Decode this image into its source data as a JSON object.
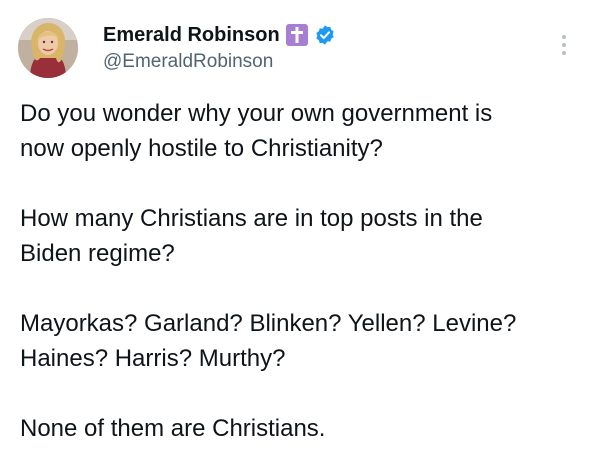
{
  "tweet": {
    "author": {
      "display_name": "Emerald Robinson",
      "handle": "@EmeraldRobinson",
      "badges": [
        "cross-emoji-icon",
        "verified-badge-icon"
      ],
      "avatar_icon": "profile-photo"
    },
    "paragraphs": [
      [
        "Do you wonder why your own government is",
        "now openly hostile to Christianity?"
      ],
      [
        "How many Christians are in top posts in the",
        "Biden regime?"
      ],
      [
        "Mayorkas? Garland? Blinken? Yellen? Levine?",
        "Haines? Harris? Murthy?"
      ],
      [
        "None of them are Christians."
      ]
    ],
    "more_icon": "vertical-ellipsis-icon"
  },
  "colors": {
    "text": "#0f1419",
    "secondary_text": "#536471",
    "verified_blue": "#1d9bf0",
    "cross_badge": "#a77fd2"
  }
}
